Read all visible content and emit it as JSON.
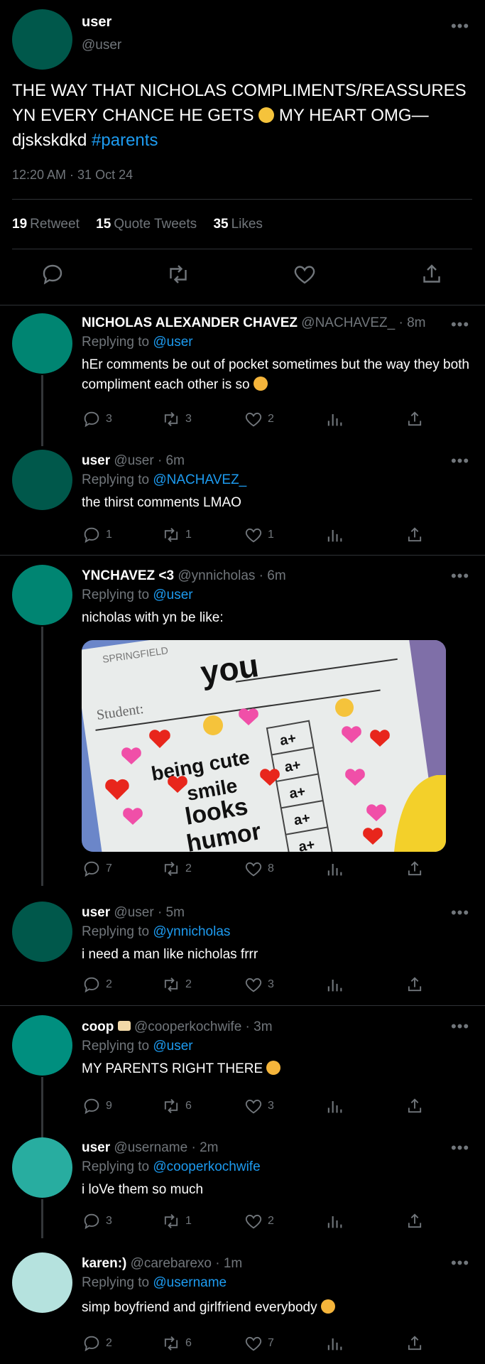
{
  "main_tweet": {
    "avatar_color": "#00584b",
    "name": "user",
    "handle": "@user",
    "text": "THE WAY THAT NICHOLAS COMPLIMENTS/REASSURES YN EVERY CHANCE HE GETS",
    "text_emoji": "pleading-face-emoji",
    "text_after_emoji": " MY HEART OMG— djskskdkd ",
    "hashtag": "#parents",
    "time": "12:20 AM · 31 Oct 24",
    "stats": {
      "retweets": "19",
      "retweets_label": "Retweet",
      "quotes": "15",
      "quotes_label": "Quote Tweets",
      "likes": "35",
      "likes_label": "Likes"
    }
  },
  "replies": [
    {
      "avatar_color": "#008572",
      "name": "NICHOLAS ALEXANDER CHAVEZ",
      "handle": "@NACHAVEZ_ · 8m",
      "replying_prefix": "Replying to",
      "replying_to": "@user",
      "text": "hEr comments be out of pocket sometimes but the way they both compliment each other is so",
      "emoji": "smiling-face-with-hearts-emoji",
      "counts": {
        "reply": "3",
        "retweet": "3",
        "like": "2"
      }
    },
    {
      "avatar_color": "#00584b",
      "name": "user",
      "handle": "@user · 6m",
      "replying_prefix": "Replying to",
      "replying_to": "@NACHAVEZ_",
      "text": "the thirst comments LMAO",
      "counts": {
        "reply": "1",
        "retweet": "1",
        "like": "1"
      }
    },
    {
      "avatar_color": "#008572",
      "name": "YNCHAVEZ <3",
      "handle": "@ynnicholas · 6m",
      "replying_prefix": "Replying to",
      "replying_to": "@user",
      "text": "nicholas with yn be like:",
      "meme": {
        "header": "SPRINGFIELD",
        "title": "you",
        "student_label": "Student:",
        "items": [
          "being cute",
          "smile",
          "looks",
          "humor"
        ],
        "grades": [
          "a+",
          "a+",
          "a+",
          "a+",
          "a+"
        ]
      },
      "counts": {
        "reply": "7",
        "retweet": "2",
        "like": "8"
      }
    },
    {
      "avatar_color": "#00584b",
      "name": "user",
      "handle": "@user · 5m",
      "replying_prefix": "Replying to",
      "replying_to": "@ynnicholas",
      "text": "i need a man like nicholas frrr",
      "counts": {
        "reply": "2",
        "retweet": "2",
        "like": "3"
      }
    },
    {
      "avatar_color": "#008f7f",
      "name": "coop",
      "name_emoji": "love-letter-emoji",
      "handle": "@cooperkochwife · 3m",
      "replying_prefix": "Replying to",
      "replying_to": "@user",
      "text": "MY PARENTS RIGHT THERE",
      "emoji": "heart-eyes-emoji",
      "counts": {
        "reply": "9",
        "retweet": "6",
        "like": "3"
      }
    },
    {
      "avatar_color": "#28ada0",
      "name": "user",
      "handle": "@username · 2m",
      "replying_prefix": "Replying to",
      "replying_to": "@cooperkochwife",
      "text": "i loVe them so much",
      "counts": {
        "reply": "3",
        "retweet": "1",
        "like": "2"
      }
    },
    {
      "avatar_color": "#b5e2de",
      "name": "karen:)",
      "handle": "@carebarexo · 1m",
      "replying_prefix": "Replying to",
      "replying_to": "@username",
      "text": "simp boyfriend and girlfriend everybody",
      "emoji": "smiling-face-with-hearts-emoji",
      "counts": {
        "reply": "2",
        "retweet": "6",
        "like": "7"
      }
    }
  ],
  "colors": {
    "accent": "#1d9bf0",
    "muted": "#71767b",
    "divider": "#2f3336"
  }
}
